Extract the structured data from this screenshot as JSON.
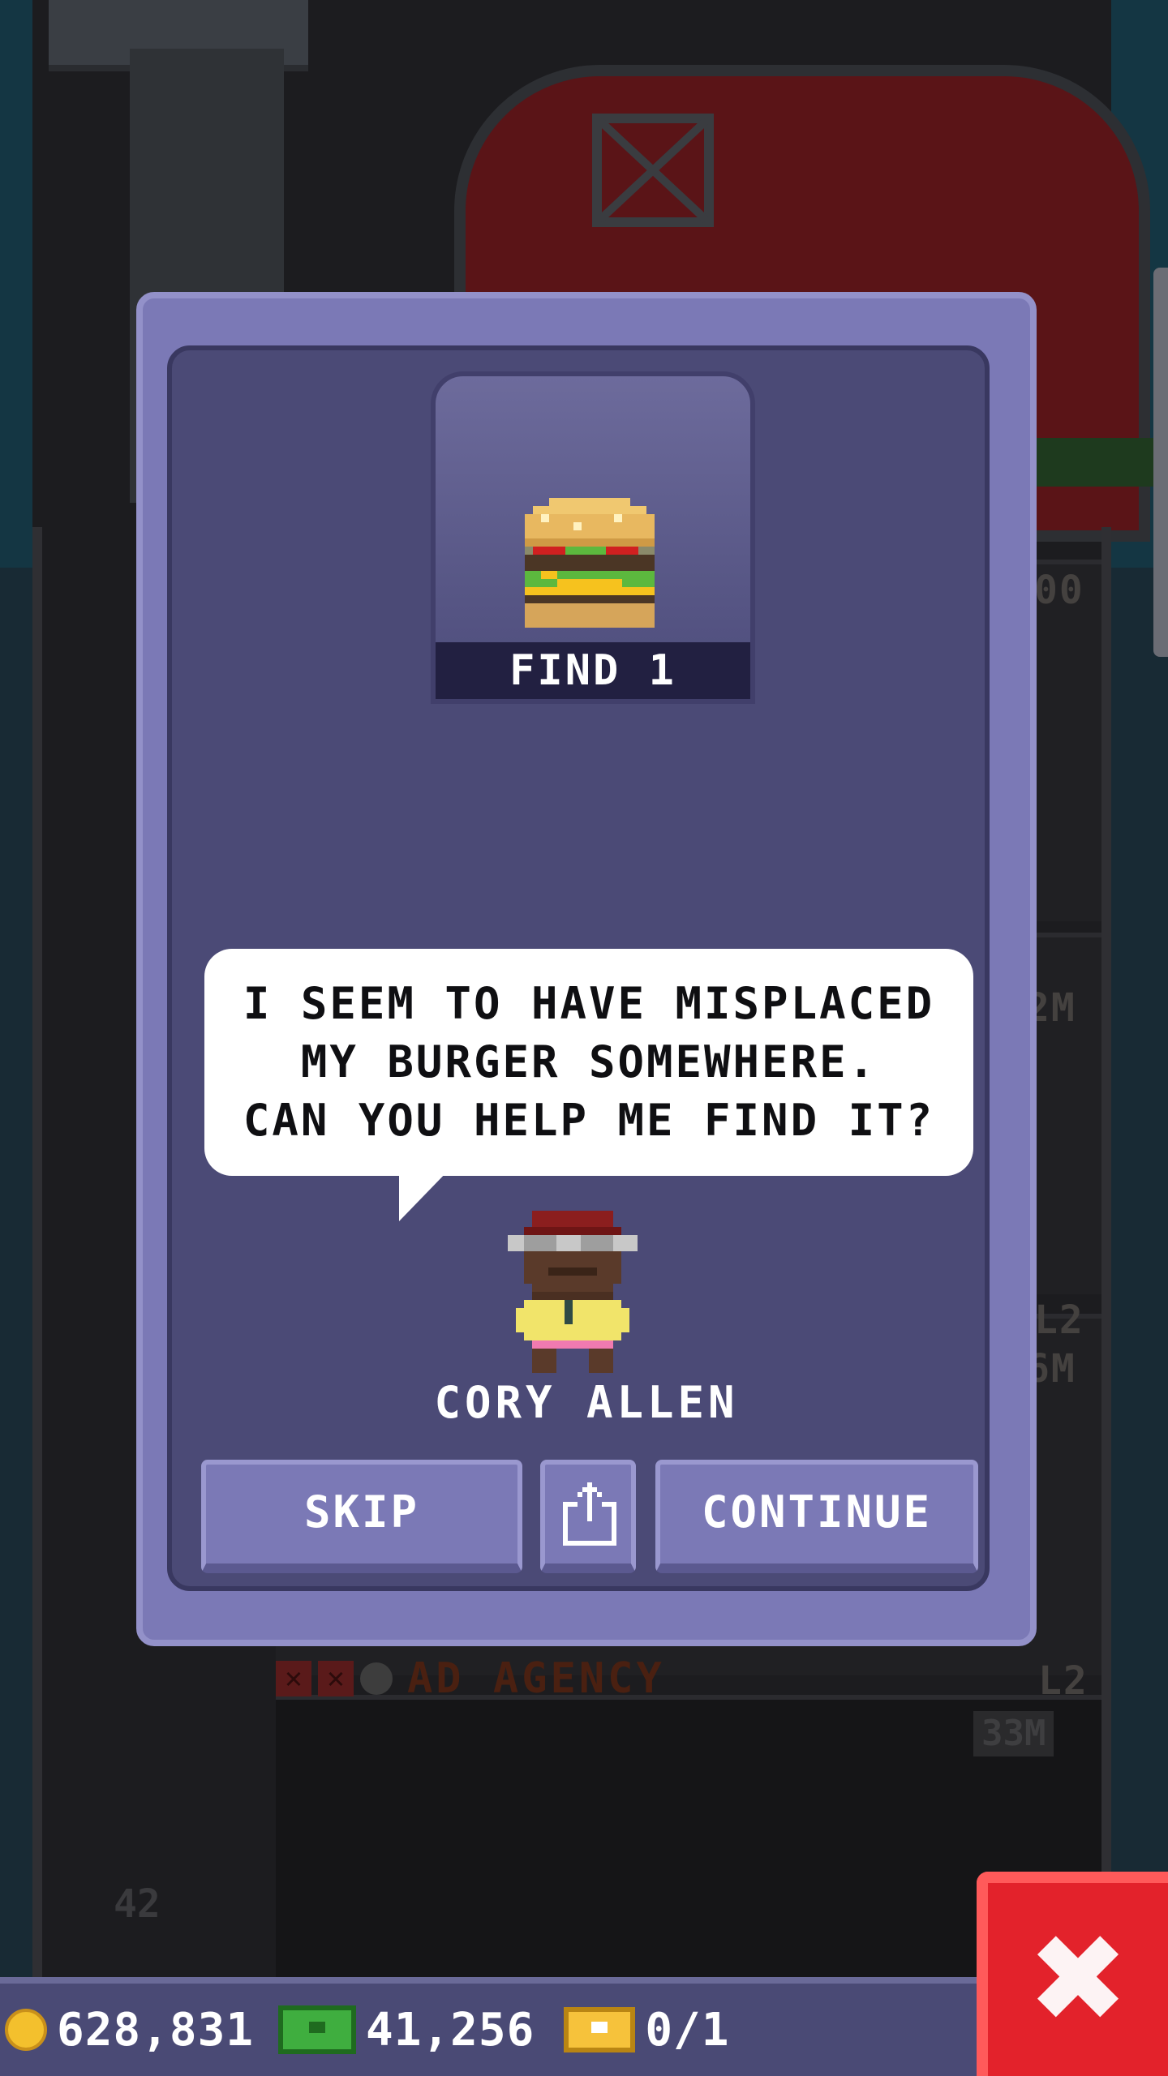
{
  "background": {
    "floor_labels": [
      "00",
      "2M",
      "L2",
      "6M"
    ],
    "ad_agency_label": "AD AGENCY",
    "ad_agency_level": "L2",
    "ad_agency_money": "33M",
    "floor_number": "42"
  },
  "dialog": {
    "find_label": "FIND 1",
    "item_icon": "burger-icon",
    "speech": "I SEEM TO HAVE MISPLACED\nMY BURGER SOMEWHERE.\nCAN YOU HELP ME FIND IT?",
    "character_name": "CORY ALLEN",
    "buttons": {
      "skip": "SKIP",
      "share_icon": "share-icon",
      "continue": "CONTINUE"
    }
  },
  "currency": {
    "coins": "628,831",
    "bux": "41,256",
    "tickets": "0/1"
  },
  "colors": {
    "dialog_border": "#7b79b6",
    "dialog_inner": "#4b4a76",
    "close_ad": "#e3222b",
    "currency_bar": "#4a4a75"
  }
}
